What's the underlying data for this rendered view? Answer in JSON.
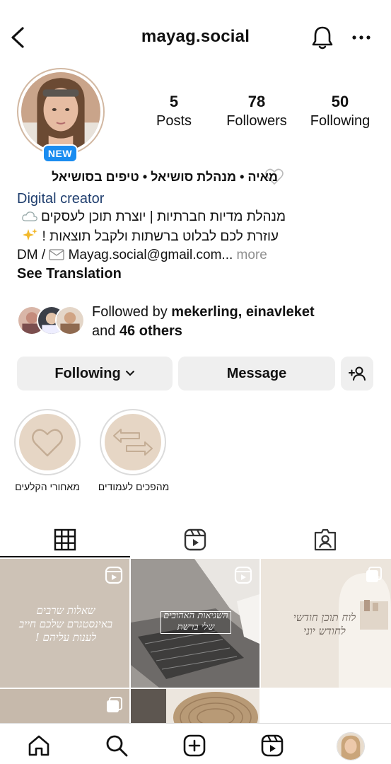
{
  "header": {
    "username": "mayag.social"
  },
  "stats": {
    "posts": {
      "value": "5",
      "label": "Posts"
    },
    "followers": {
      "value": "78",
      "label": "Followers"
    },
    "following": {
      "value": "50",
      "label": "Following"
    }
  },
  "profile": {
    "badge": "NEW",
    "name": "מאיה • מנהלת סושיאל • טיפים בסושיאל",
    "category": "Digital creator",
    "bio_line1": "מנהלת מדיות חברתיות | יוצרת תוכן לעסקים",
    "bio_line2": "עוזרת לכם לבלוט ברשתות ולקבל תוצאות !",
    "bio_line3_prefix": "DM /",
    "bio_line3_email": "Mayag.social@gmail.com...",
    "more": "more",
    "see_translation": "See Translation"
  },
  "followed_by": {
    "prefix": "Followed by ",
    "names": "mekerling, einavleket",
    "and": "and ",
    "others": "46 others"
  },
  "actions": {
    "following_label": "Following",
    "message_label": "Message"
  },
  "highlights": [
    {
      "label": "מאחורי הקלעים",
      "icon": "heart-icon"
    },
    {
      "label": "מהפכים לעמודים",
      "icon": "swap-arrows-icon"
    }
  ],
  "tabs": [
    {
      "icon": "grid-icon",
      "active": true
    },
    {
      "icon": "reels-icon",
      "active": false
    },
    {
      "icon": "tagged-icon",
      "active": false
    }
  ],
  "posts": [
    {
      "text": "שאלות שרבים באינסטגרם שלכם חייב לענות עליהם !",
      "type": "reel"
    },
    {
      "text": "השגיאות האהובים שלי ברשת",
      "type": "reel"
    },
    {
      "text": "לוח תוכן חודשי לחודש יוני",
      "type": "carousel"
    }
  ],
  "colors": {
    "accent_blue": "#1a8cf0",
    "link_dark_blue": "#1f3e6e",
    "highlight_beige": "#e6d6c5",
    "button_gray": "#efefef"
  }
}
